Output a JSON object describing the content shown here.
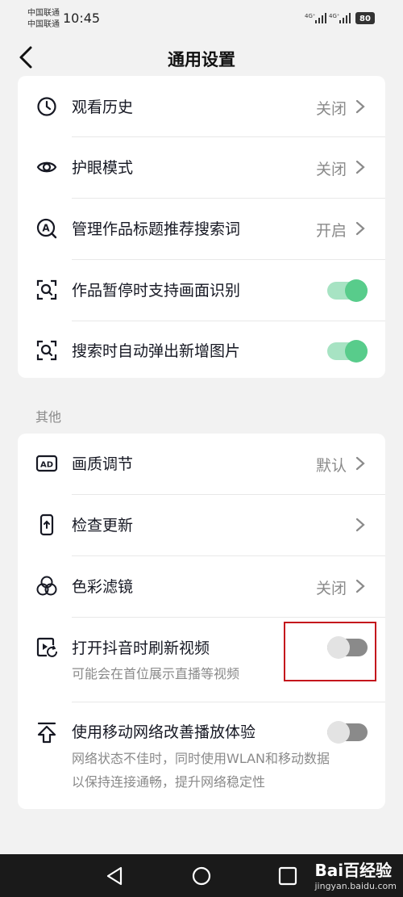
{
  "status_bar": {
    "carrier1": "中国联通",
    "carrier2": "中国联通",
    "time": "10:45",
    "sig1": "4G⁺",
    "sig2": "4G⁺",
    "battery": "80"
  },
  "header": {
    "title": "通用设置",
    "back_icon": "chevron-left-icon"
  },
  "group1": [
    {
      "label": "观看历史",
      "value": "关闭",
      "icon": "clock-icon"
    },
    {
      "label": "护眼模式",
      "value": "关闭",
      "icon": "eye-icon"
    },
    {
      "label": "管理作品标题推荐搜索词",
      "value": "开启",
      "icon": "search-a-icon"
    },
    {
      "label": "作品暂停时支持画面识别",
      "toggle": "on",
      "icon": "scan-search-icon"
    },
    {
      "label": "搜索时自动弹出新增图片",
      "toggle": "on",
      "icon": "scan-search-icon"
    }
  ],
  "section_title": "其他",
  "group2": [
    {
      "label": "画质调节",
      "value": "默认",
      "icon": "ad-icon"
    },
    {
      "label": "检查更新",
      "value": "",
      "icon": "phone-update-icon"
    },
    {
      "label": "色彩滤镜",
      "value": "关闭",
      "icon": "color-filter-icon"
    },
    {
      "label": "打开抖音时刷新视频",
      "sub": "可能会在首位展示直播等视频",
      "toggle": "off",
      "icon": "refresh-video-icon"
    },
    {
      "label": "使用移动网络改善播放体验",
      "sub1": "网络状态不佳时，同时使用WLAN和移动数据",
      "sub2": "以保持连接通畅，提升网络稳定性",
      "toggle": "off",
      "icon": "upload-arrow-icon"
    }
  ],
  "watermark": {
    "main": "Bai百经验",
    "sub": "jingyan.baidu.com"
  },
  "colors": {
    "toggle_on": "#58cc8b",
    "highlight": "#c4151c"
  }
}
